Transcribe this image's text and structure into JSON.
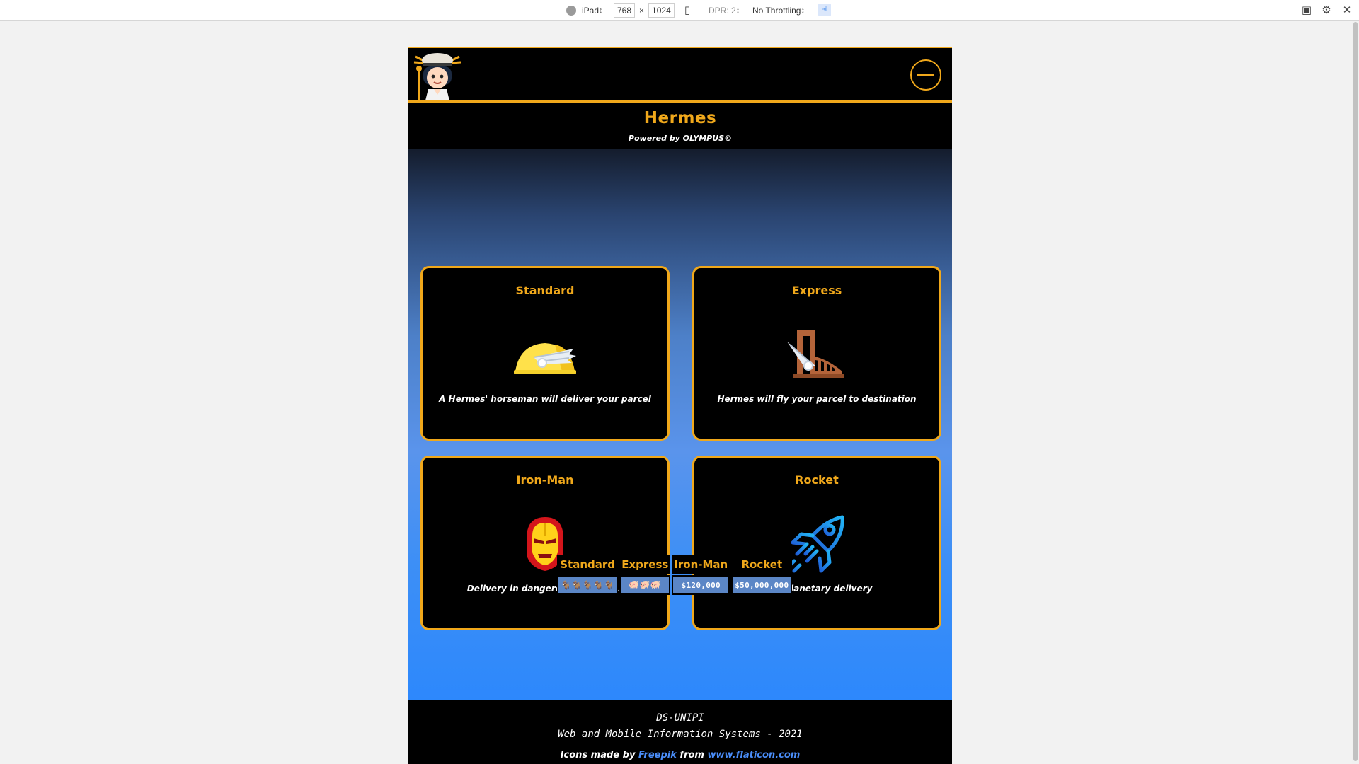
{
  "devtools": {
    "device": "iPad",
    "width": "768",
    "height": "1024",
    "dpr": "DPR: 2",
    "throttling": "No Throttling",
    "times": "×"
  },
  "header": {
    "title": "Hermes",
    "powered_by": "Powered by OLYMPUS©"
  },
  "cards": [
    {
      "title": "Standard",
      "description": "A Hermes' horseman will deliver your parcel",
      "icon": "winged-helmet-icon"
    },
    {
      "title": "Express",
      "description": "Hermes will fly your parcel to destination",
      "icon": "winged-sandal-icon"
    },
    {
      "title": "Iron-Man",
      "description": "Delivery in dangerous situations",
      "icon": "iron-man-helmet-icon"
    },
    {
      "title": "Rocket",
      "description": "Interplanetary delivery",
      "icon": "rocket-icon"
    }
  ],
  "pricing": {
    "headers": [
      "Standard",
      "Express",
      "Iron-Man",
      "Rocket"
    ],
    "values": [
      "🐐🐐🐐🐐🐐",
      "🐖🐖🐖",
      "$120,000",
      "$50,000,000"
    ]
  },
  "footer": {
    "org": "DS-UNIPI",
    "course": "Web and Mobile Information Systems - 2021",
    "credit_prefix": "Icons made by",
    "credit_author": "Freepik",
    "credit_from": "from",
    "credit_site": "www.flaticon.com"
  },
  "colors": {
    "accent": "#f0a81b",
    "background": "#000000",
    "link": "#4a8df8"
  }
}
